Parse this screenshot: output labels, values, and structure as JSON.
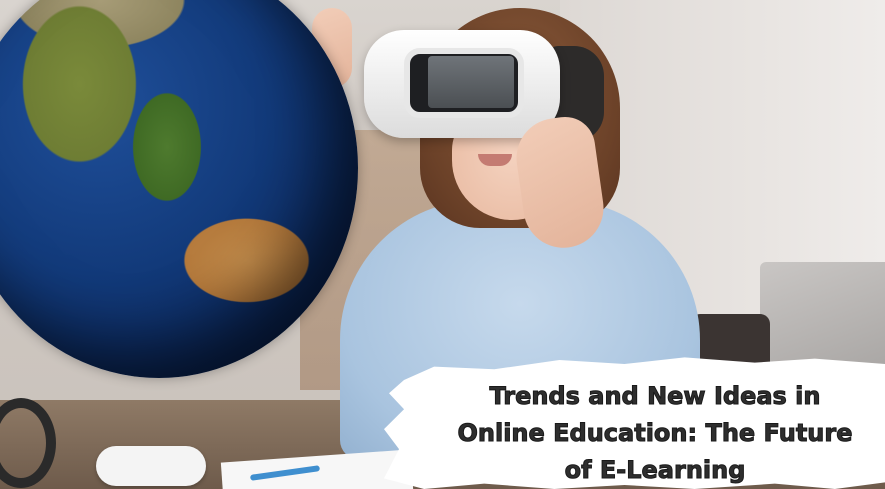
{
  "image": {
    "caption": {
      "lines": [
        "Trends and New Ideas in",
        "Online Education: The Future",
        "of E-Learning"
      ]
    }
  }
}
